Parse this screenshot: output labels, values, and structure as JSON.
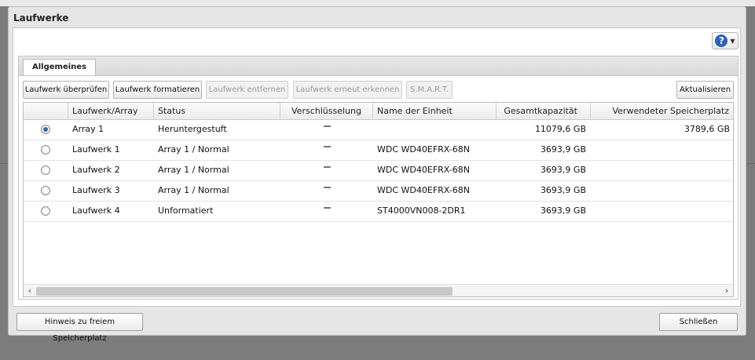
{
  "dialog": {
    "title": "Laufwerke"
  },
  "help": {
    "icon": "help-icon",
    "symbol": "?"
  },
  "tabs": [
    {
      "label": "Allgemeines"
    }
  ],
  "toolbar": {
    "check_label": "Laufwerk überprüfen",
    "format_label": "Laufwerk formatieren",
    "remove_label": "Laufwerk entfernen",
    "redetect_label": "Laufwerk erneut erkennen",
    "smart_label": "S.M.A.R.T.",
    "refresh_label": "Aktualisieren"
  },
  "table": {
    "columns": [
      "Laufwerk/Array",
      "Status",
      "Verschlüsselung",
      "Name der Einheit",
      "Gesamtkapazität",
      "Verwendeter Speicherplatz"
    ],
    "rows": [
      {
        "selected": true,
        "drive": "Array 1",
        "status": "Heruntergestuft",
        "encryption": "",
        "unit": "",
        "capacity": "11079,6 GB",
        "used": "3789,6 GB"
      },
      {
        "selected": false,
        "drive": "Laufwerk 1",
        "status": "Array 1 / Normal",
        "encryption": "",
        "unit": "WDC WD40EFRX-68N",
        "capacity": "3693,9 GB",
        "used": ""
      },
      {
        "selected": false,
        "drive": "Laufwerk 2",
        "status": "Array 1 / Normal",
        "encryption": "",
        "unit": "WDC WD40EFRX-68N",
        "capacity": "3693,9 GB",
        "used": ""
      },
      {
        "selected": false,
        "drive": "Laufwerk 3",
        "status": "Array 1 / Normal",
        "encryption": "",
        "unit": "WDC WD40EFRX-68N",
        "capacity": "3693,9 GB",
        "used": ""
      },
      {
        "selected": false,
        "drive": "Laufwerk 4",
        "status": "Unformatiert",
        "encryption": "",
        "unit": "ST4000VN008-2DR1",
        "capacity": "3693,9 GB",
        "used": ""
      }
    ]
  },
  "footer": {
    "hint_label": "Hinweis zu freiem Speicherplatz",
    "close_label": "Schließen"
  }
}
